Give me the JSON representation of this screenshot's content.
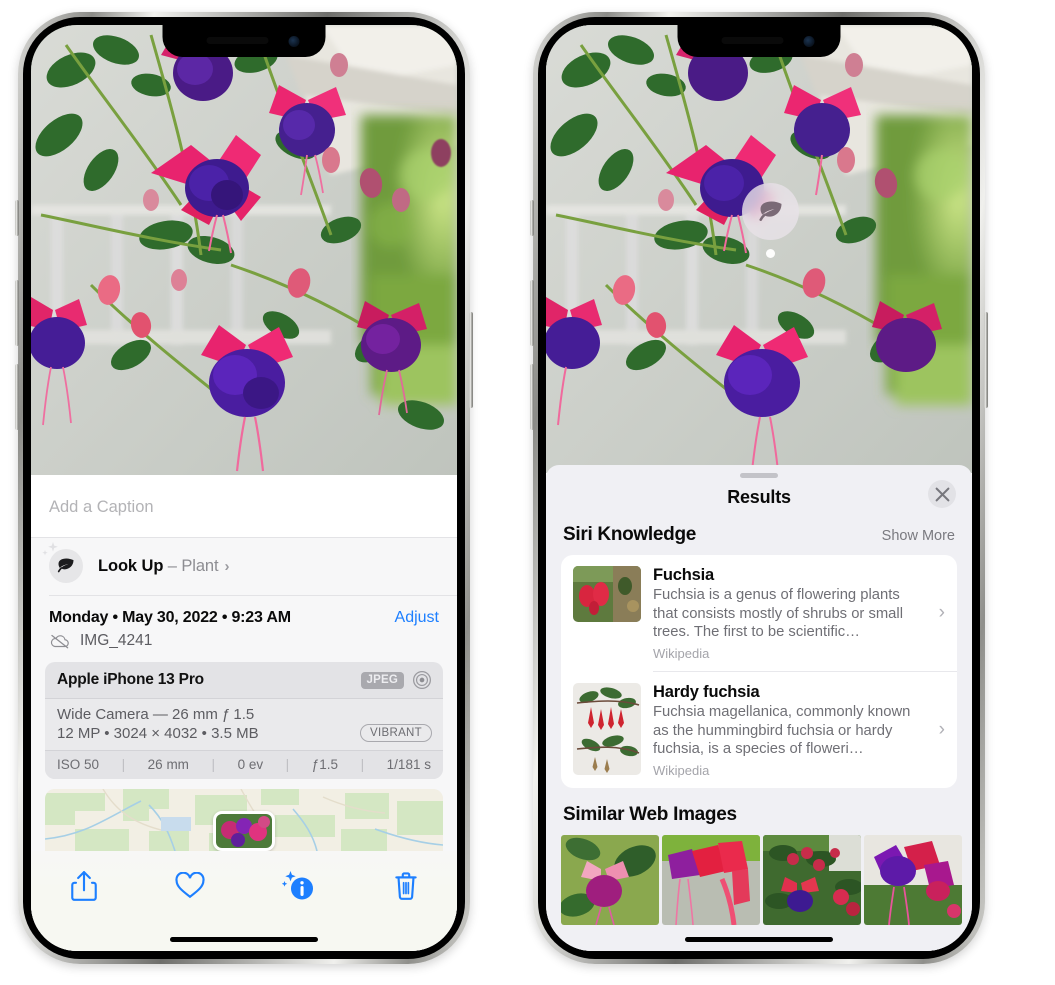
{
  "left_phone": {
    "caption": {
      "placeholder": "Add a Caption",
      "value": ""
    },
    "lookup": {
      "label": "Look Up",
      "dash": " – ",
      "subject": "Plant",
      "chevron": "›",
      "icon": "leaf-icon"
    },
    "date": {
      "text": "Monday • May 30, 2022 • 9:23 AM",
      "adjust_label": "Adjust"
    },
    "filename": {
      "text": "IMG_4241",
      "icon": "icloud-slash-icon"
    },
    "camera": {
      "model": "Apple iPhone 13 Pro",
      "format_badge": "JPEG",
      "aperture_icon": "lens-icon",
      "lens_line": "Wide Camera — 26 mm ƒ 1.5",
      "spec_line": "12 MP • 3024 × 4032 • 3.5 MB",
      "style_badge": "VIBRANT",
      "exif": [
        "ISO 50",
        "26 mm",
        "0 ev",
        "ƒ1.5",
        "1/181 s"
      ]
    },
    "toolbar": [
      {
        "name": "share-button",
        "icon": "share-icon"
      },
      {
        "name": "favorite-button",
        "icon": "heart-icon"
      },
      {
        "name": "info-button",
        "icon": "info-sparkle-icon"
      },
      {
        "name": "delete-button",
        "icon": "trash-icon"
      }
    ]
  },
  "right_phone": {
    "pin": {
      "icon": "leaf-icon"
    },
    "results": {
      "title": "Results",
      "close_icon": "close-icon",
      "siri_section": {
        "title": "Siri Knowledge",
        "show_more": "Show More"
      },
      "entries": [
        {
          "name": "Fuchsia",
          "description": "Fuchsia is a genus of flowering plants that consists mostly of shrubs or small trees. The first to be scientific…",
          "source": "Wikipedia",
          "chevron": "›"
        },
        {
          "name": "Hardy fuchsia",
          "description": "Fuchsia magellanica, commonly known as the hummingbird fuchsia or hardy fuchsia, is a species of floweri…",
          "source": "Wikipedia",
          "chevron": "›"
        }
      ],
      "similar_section": {
        "title": "Similar Web Images"
      },
      "similar_count": 4
    }
  },
  "colors": {
    "accent_blue": "#1d7fff",
    "sheet_bg": "#f0f0f4",
    "card_bg": "#ffffff",
    "camera_card_bg": "#e3e3e6",
    "text_primary": "#0a0a0a",
    "text_secondary": "#6f6f75",
    "text_tertiary": "#a4a4aa"
  }
}
